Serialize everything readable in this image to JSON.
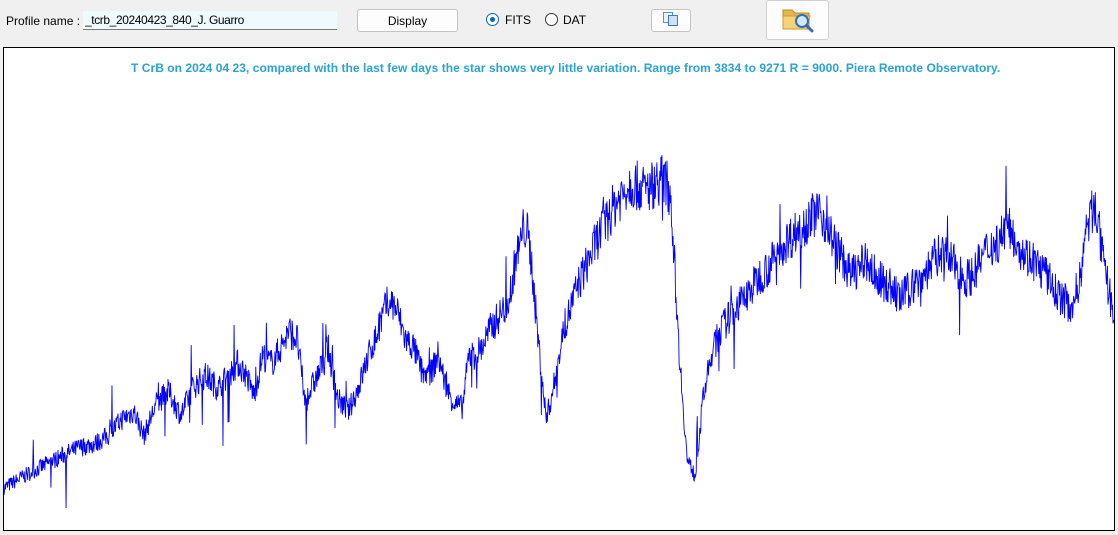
{
  "toolbar": {
    "profile_label": "Profile name :",
    "profile_value": "_tcrb_20240423_840_J. Guarro",
    "display_label": "Display",
    "format_options": [
      {
        "label": "FITS",
        "selected": true
      },
      {
        "label": "DAT",
        "selected": false
      }
    ],
    "copy_button_icon": "copy-icon",
    "open_button_icon": "folder-search-icon"
  },
  "plot": {
    "annotation": "T CrB on 2024 04 23,  compared with the last few days the star shows very little variation. Range  from 3834 to 9271 R = 9000.  Piera Remote Observatory.",
    "line_color": "#0000ff",
    "annotation_color": "#29a3d6"
  },
  "chart_data": {
    "type": "line",
    "title": "",
    "xlabel": "",
    "ylabel": "",
    "x_range": [
      3834,
      9271
    ],
    "y_range": [
      0,
      1
    ],
    "grid": false,
    "legend": false,
    "series": [
      {
        "x": [
          3834,
          3900,
          3970,
          4045,
          4120,
          4200,
          4280,
          4345,
          4410,
          4470,
          4520,
          4580,
          4640,
          4700,
          4760,
          4820,
          4880,
          4935,
          4980,
          5020,
          5060,
          5100,
          5145,
          5190,
          5230,
          5270,
          5310,
          5340,
          5380,
          5420,
          5470,
          5520,
          5570,
          5620,
          5660,
          5690,
          5720,
          5760,
          5800,
          5840,
          5880,
          5920,
          5960,
          6000,
          6040,
          6080,
          6110,
          6140,
          6175,
          6210,
          6250,
          6290,
          6320,
          6340,
          6360,
          6380,
          6400,
          6420,
          6450,
          6490,
          6530,
          6570,
          6610,
          6650,
          6700,
          6740,
          6780,
          6820,
          6860,
          6900,
          6940,
          6980,
          7020,
          7060,
          7100,
          7140,
          7180,
          7220,
          7260,
          7300,
          7340,
          7380,
          7420,
          7460,
          7500,
          7540,
          7580,
          7620,
          7660,
          7700,
          7740,
          7780,
          7820,
          7860,
          7900,
          7940,
          7980,
          8020,
          8060,
          8100,
          8140,
          8180,
          8220,
          8260,
          8300,
          8340,
          8380,
          8420,
          8460,
          8500,
          8540,
          8580,
          8620,
          8660,
          8700,
          8740,
          8780,
          8820,
          8860,
          8900,
          8940,
          8980,
          9020,
          9060,
          9100,
          9140,
          9180,
          9220,
          9271
        ],
        "y": [
          0.05,
          0.07,
          0.09,
          0.11,
          0.13,
          0.15,
          0.16,
          0.18,
          0.22,
          0.24,
          0.18,
          0.26,
          0.29,
          0.23,
          0.3,
          0.33,
          0.3,
          0.33,
          0.36,
          0.33,
          0.28,
          0.38,
          0.36,
          0.4,
          0.44,
          0.42,
          0.26,
          0.3,
          0.34,
          0.4,
          0.27,
          0.24,
          0.3,
          0.38,
          0.43,
          0.48,
          0.52,
          0.49,
          0.42,
          0.4,
          0.34,
          0.33,
          0.38,
          0.3,
          0.26,
          0.25,
          0.38,
          0.38,
          0.4,
          0.44,
          0.47,
          0.5,
          0.55,
          0.62,
          0.65,
          0.7,
          0.68,
          0.6,
          0.42,
          0.22,
          0.31,
          0.43,
          0.5,
          0.56,
          0.62,
          0.67,
          0.71,
          0.75,
          0.78,
          0.81,
          0.8,
          0.79,
          0.81,
          0.82,
          0.78,
          0.4,
          0.12,
          0.08,
          0.28,
          0.38,
          0.44,
          0.47,
          0.5,
          0.52,
          0.55,
          0.58,
          0.6,
          0.63,
          0.66,
          0.68,
          0.7,
          0.72,
          0.74,
          0.71,
          0.66,
          0.62,
          0.58,
          0.6,
          0.61,
          0.58,
          0.56,
          0.55,
          0.52,
          0.54,
          0.56,
          0.58,
          0.61,
          0.64,
          0.62,
          0.6,
          0.57,
          0.58,
          0.62,
          0.65,
          0.66,
          0.7,
          0.68,
          0.64,
          0.62,
          0.6,
          0.58,
          0.54,
          0.52,
          0.5,
          0.56,
          0.7,
          0.76,
          0.6,
          0.48
        ]
      }
    ]
  }
}
